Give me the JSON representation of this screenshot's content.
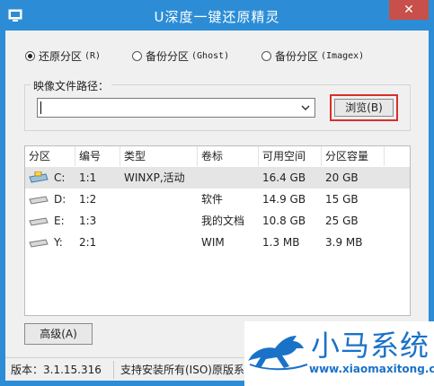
{
  "window": {
    "title": "U深度一键还原精灵",
    "close_label": "✕",
    "colors": {
      "titlebar": "#2c8dd6",
      "close": "#c7504a",
      "highlight": "#d8302a"
    }
  },
  "mode": {
    "options": [
      {
        "label": "还原分区",
        "hotkey": "(R)",
        "selected": true
      },
      {
        "label": "备份分区",
        "hotkey": "(Ghost)",
        "selected": false
      },
      {
        "label": "备份分区",
        "hotkey": "(Imagex)",
        "selected": false
      }
    ]
  },
  "image_path": {
    "group_label": "映像文件路径：",
    "value": "",
    "browse_label": "浏览(B)"
  },
  "partitions": {
    "columns": [
      "分区",
      "编号",
      "类型",
      "卷标",
      "可用空间",
      "分区容量"
    ],
    "rows": [
      {
        "drive": "C:",
        "number": "1:1",
        "type": "WINXP,活动",
        "label": "",
        "free": "16.4 GB",
        "size": "20 GB",
        "selected": true
      },
      {
        "drive": "D:",
        "number": "1:2",
        "type": "",
        "label": "软件",
        "free": "14.9 GB",
        "size": "15 GB",
        "selected": false
      },
      {
        "drive": "E:",
        "number": "1:3",
        "type": "",
        "label": "我的文档",
        "free": "10.8 GB",
        "size": "25 GB",
        "selected": false
      },
      {
        "drive": "Y:",
        "number": "2:1",
        "type": "",
        "label": "WIM",
        "free": "1.3 MB",
        "size": "3.9 MB",
        "selected": false
      }
    ]
  },
  "buttons": {
    "advanced_label": "高级(A)"
  },
  "status": {
    "version": "版本：3.1.15.316",
    "message": "支持安装所有(ISO)原版系统"
  },
  "watermark": {
    "title": "小马系统",
    "url": "www.xiaomaxitong.com"
  }
}
